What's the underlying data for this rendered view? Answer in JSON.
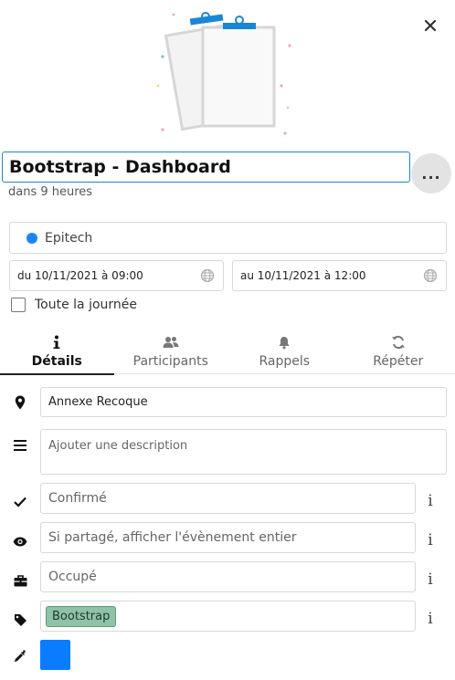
{
  "event": {
    "title": "Bootstrap - Dashboard",
    "relative_time": "dans 9 heures"
  },
  "calendar": {
    "name": "Epitech",
    "color": "#1a87f0"
  },
  "dates": {
    "start": "du 10/11/2021 à 09:00",
    "end": "au 10/11/2021 à 12:00"
  },
  "all_day": {
    "label": "Toute la journée",
    "checked": false
  },
  "tabs": [
    {
      "label": "Détails",
      "icon": "info-icon",
      "active": true
    },
    {
      "label": "Participants",
      "icon": "users-icon",
      "active": false
    },
    {
      "label": "Rappels",
      "icon": "bell-icon",
      "active": false
    },
    {
      "label": "Répéter",
      "icon": "repeat-icon",
      "active": false
    }
  ],
  "details": {
    "location": "Annexe Recoque",
    "description_placeholder": "Ajouter une description",
    "status": "Confirmé",
    "visibility": "Si partagé, afficher l'évènement entier",
    "availability": "Occupé",
    "tag": "Bootstrap",
    "tag_color": "#8fc3a6",
    "event_color": "#0a7cff",
    "info_glyph": "i"
  },
  "more_button_label": "..."
}
